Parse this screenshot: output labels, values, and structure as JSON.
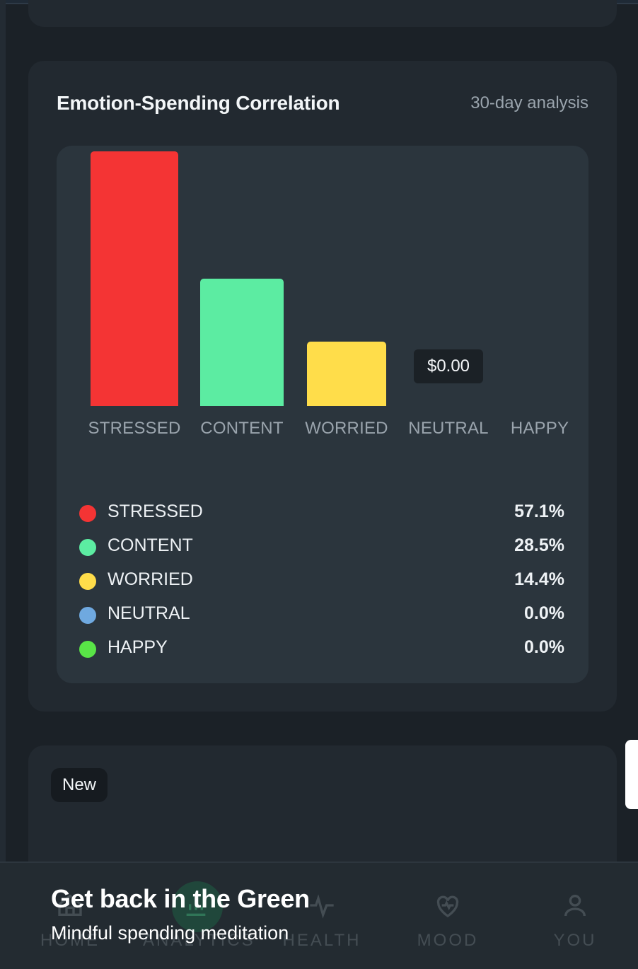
{
  "emotion_card": {
    "title": "Emotion-Spending Correlation",
    "subtitle": "30-day analysis",
    "tooltip": "$0.00"
  },
  "chart_data": {
    "type": "bar",
    "categories": [
      "STRESSED",
      "CONTENT",
      "WORRIED",
      "NEUTRAL",
      "HAPPY"
    ],
    "values": [
      57.1,
      28.5,
      14.4,
      0.0,
      0.0
    ],
    "colors": [
      "#f43434",
      "#5ceca2",
      "#ffdd4a",
      "#6fa9e0",
      "#59e447"
    ],
    "title": "",
    "xlabel": "",
    "ylabel": ""
  },
  "legend": [
    {
      "label": "STRESSED",
      "value": "57.1%",
      "color": "#f43434"
    },
    {
      "label": "CONTENT",
      "value": "28.5%",
      "color": "#5ceca2"
    },
    {
      "label": "WORRIED",
      "value": "14.4%",
      "color": "#ffdd4a"
    },
    {
      "label": "NEUTRAL",
      "value": "0.0%",
      "color": "#6fa9e0"
    },
    {
      "label": "HAPPY",
      "value": "0.0%",
      "color": "#59e447"
    }
  ],
  "promo": {
    "badge": "New",
    "title": "Get back in the Green",
    "subtitle": "Mindful spending meditation"
  },
  "nav": {
    "home": "HOME",
    "analytics": "ANALYTICS",
    "health": "HEALTH",
    "mood": "MOOD",
    "you": "YOU"
  }
}
